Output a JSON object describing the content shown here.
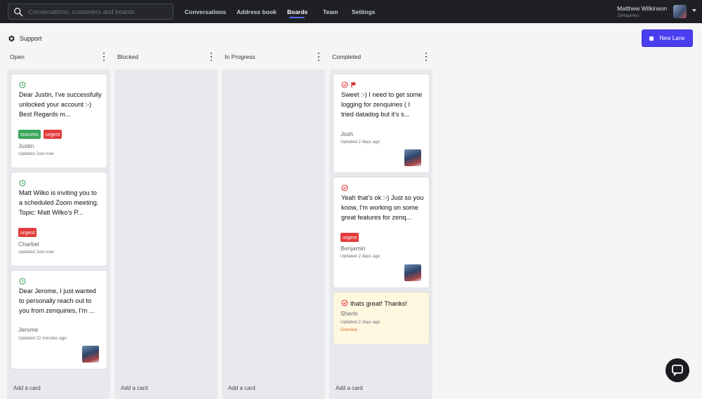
{
  "topbar": {
    "search_placeholder": "Conversations, customers and boards",
    "nav": [
      {
        "label": "Conversations"
      },
      {
        "label": "Address book"
      },
      {
        "label": "Boards"
      },
      {
        "label": "Team"
      },
      {
        "label": "Settings"
      }
    ],
    "active_nav": "Boards",
    "user_name": "Matthew Wilkinson",
    "user_org": "Zenquiries"
  },
  "board": {
    "title": "Support",
    "new_lane_label": "New Lane",
    "add_card_label": "Add a card"
  },
  "lanes": [
    {
      "title": "Open",
      "cards": [
        {
          "text": "Dear Justin, I've successfully unlocked your account :-) Best Regards m...",
          "tags": [
            "success",
            "urgent"
          ],
          "author": "Justin",
          "updated": "Updated Just now"
        },
        {
          "text": "Matt Wilko is inviting you to a scheduled Zoom meeting. Topic: Matt Wilko's P...",
          "tags": [
            "urgent"
          ],
          "author": "Charbel",
          "updated": "Updated Just now"
        },
        {
          "text": "Dear Jerome, I just wanted to personally reach out to you from zenquiries, I'm ...",
          "tags": [],
          "author": "Jerome",
          "updated": "Updated 22 minutes ago"
        }
      ]
    },
    {
      "title": "Blocked",
      "cards": []
    },
    {
      "title": "In Progress",
      "cards": []
    },
    {
      "title": "Completed",
      "cards": [
        {
          "text": "Sweet :-) I need to get some logging for zenquiries ( I tried datadog but it's s...",
          "tags": [],
          "author": "Josh",
          "updated": "Updated 2 days ago"
        },
        {
          "text": "Yeah that's ok :-) Just so you know, I'm working on some great features for zenq...",
          "tags": [
            "urgent"
          ],
          "author": "Benjamin",
          "updated": "Updated 2 days ago"
        },
        {
          "text": "thats great! Thanks!",
          "tags": [],
          "author": "Sherin",
          "updated": "Updated 2 days ago",
          "overdue": "Overdue"
        }
      ]
    }
  ],
  "colors": {
    "accent": "#4a3ff0",
    "tag_success": "#3aa65a",
    "tag_urgent": "#e23b3b",
    "status_open": "#3aa65a",
    "status_done": "#e23b3b",
    "overdue": "#e06b2a",
    "overdue_card_bg": "#fff8e1"
  },
  "icons": {
    "search": "search-icon",
    "settings": "gear-icon",
    "open_status": "clock-icon",
    "done_status": "check-circle-icon",
    "priority": "flag-icon",
    "menu": "kebab-icon",
    "chat": "chat-bubble-icon"
  }
}
